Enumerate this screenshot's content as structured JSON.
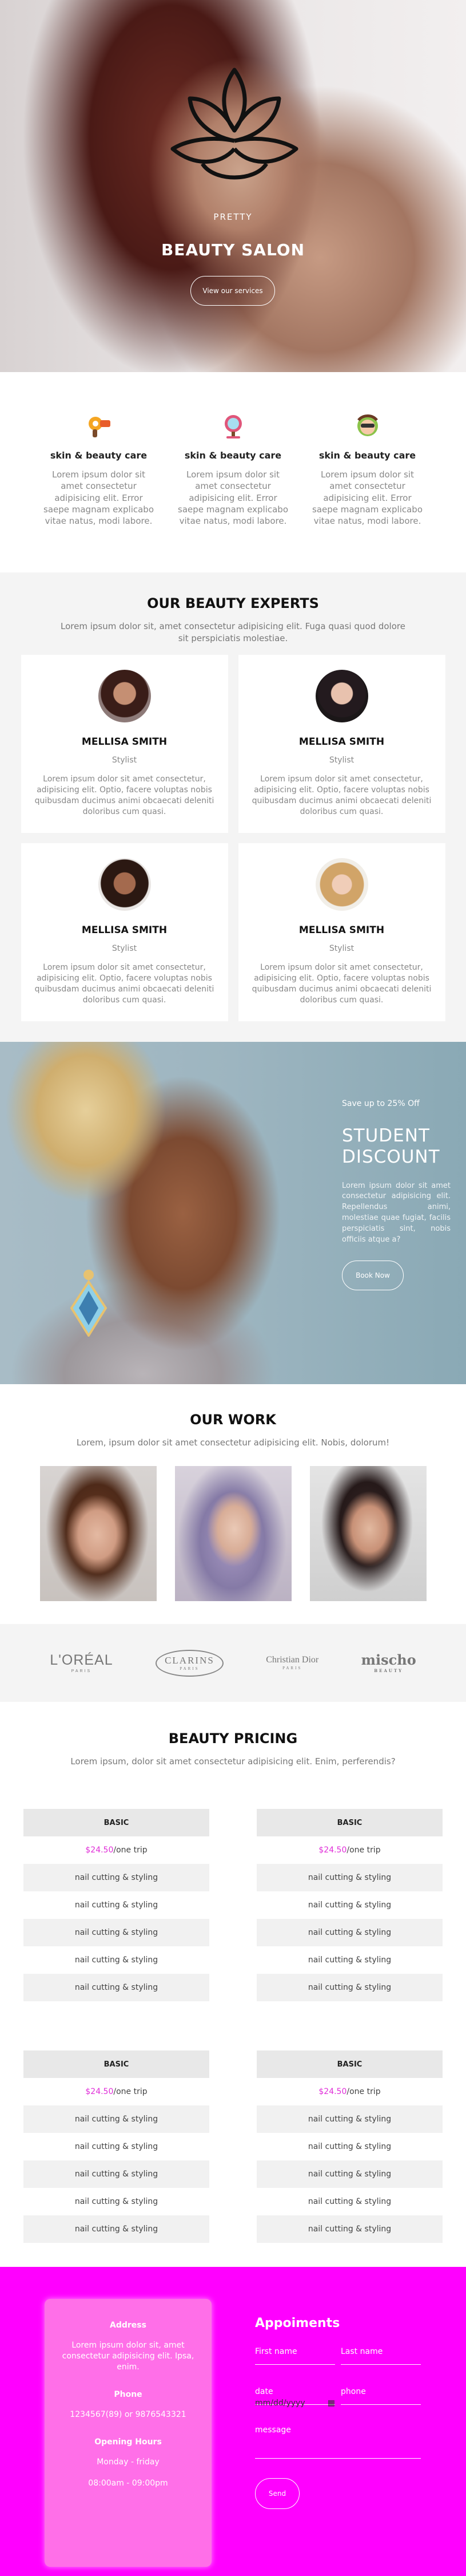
{
  "hero": {
    "tagline": "PRETTY",
    "title": "BEAUTY SALON",
    "button": "View our services"
  },
  "services": [
    {
      "icon": "hair-dryer-icon",
      "title": "skin & beauty care",
      "text": "Lorem ipsum dolor sit amet consectetur adipisicing elit. Error saepe magnam explicabo vitae natus, modi labore."
    },
    {
      "icon": "mirror-icon",
      "title": "skin & beauty care",
      "text": "Lorem ipsum dolor sit amet consectetur adipisicing elit. Error saepe magnam explicabo vitae natus, modi labore."
    },
    {
      "icon": "face-mask-icon",
      "title": "skin & beauty care",
      "text": "Lorem ipsum dolor sit amet consectetur adipisicing elit. Error saepe magnam explicabo vitae natus, modi labore."
    }
  ],
  "experts": {
    "title": "OUR BEAUTY EXPERTS",
    "subtitle": "Lorem ipsum dolor sit, amet consectetur adipisicing elit. Fuga quasi quod dolore sit perspiciatis molestiae.",
    "cards": [
      {
        "name": "MELLISA SMITH",
        "role": "Stylist",
        "text": "Lorem ipsum dolor sit amet consectetur, adipisicing elit. Optio, facere voluptas nobis quibusdam ducimus animi obcaecati deleniti doloribus cum quasi."
      },
      {
        "name": "MELLISA SMITH",
        "role": "Stylist",
        "text": "Lorem ipsum dolor sit amet consectetur, adipisicing elit. Optio, facere voluptas nobis quibusdam ducimus animi obcaecati deleniti doloribus cum quasi."
      },
      {
        "name": "MELLISA SMITH",
        "role": "Stylist",
        "text": "Lorem ipsum dolor sit amet consectetur, adipisicing elit. Optio, facere voluptas nobis quibusdam ducimus animi obcaecati deleniti doloribus cum quasi."
      },
      {
        "name": "MELLISA SMITH",
        "role": "Stylist",
        "text": "Lorem ipsum dolor sit amet consectetur, adipisicing elit. Optio, facere voluptas nobis quibusdam ducimus animi obcaecati deleniti doloribus cum quasi."
      }
    ]
  },
  "discount": {
    "save": "Save up to 25% Off",
    "title": "STUDENT DISCOUNT",
    "text": "Lorem ipsum dolor sit amet consectetur adipisicing elit. Repellendus animi, molestiae quae fugiat, facilis perspiciatis sint, nobis officiis atque a?",
    "button": "Book Now"
  },
  "work": {
    "title": "OUR WORK",
    "subtitle": "Lorem, ipsum dolor sit amet consectetur adipisicing elit. Nobis, dolorum!"
  },
  "brands": [
    {
      "name": "L'ORÉAL",
      "sub": "PARIS"
    },
    {
      "name": "CLARINS",
      "sub": "PARIS"
    },
    {
      "name": "Christian Dior",
      "sub": "PARIS"
    },
    {
      "name": "mischo",
      "sub": "BEAUTY"
    }
  ],
  "pricing": {
    "title": "BEAUTY PRICING",
    "subtitle": "Lorem ipsum, dolor sit amet consectetur adipisicing elit. Enim, perferendis?",
    "plans": [
      {
        "name": "BASIC",
        "price": "$24.50",
        "period": "/one trip",
        "items": [
          "nail cutting & styling",
          "nail cutting & styling",
          "nail cutting & styling",
          "nail cutting & styling",
          "nail cutting & styling"
        ]
      },
      {
        "name": "BASIC",
        "price": "$24.50",
        "period": "/one trip",
        "items": [
          "nail cutting & styling",
          "nail cutting & styling",
          "nail cutting & styling",
          "nail cutting & styling",
          "nail cutting & styling"
        ]
      },
      {
        "name": "BASIC",
        "price": "$24.50",
        "period": "/one trip",
        "items": [
          "nail cutting & styling",
          "nail cutting & styling",
          "nail cutting & styling",
          "nail cutting & styling",
          "nail cutting & styling"
        ]
      },
      {
        "name": "BASIC",
        "price": "$24.50",
        "period": "/one trip",
        "items": [
          "nail cutting & styling",
          "nail cutting & styling",
          "nail cutting & styling",
          "nail cutting & styling",
          "nail cutting & styling"
        ]
      }
    ]
  },
  "contact": {
    "address_label": "Address",
    "address": "Lorem ipsum dolor sit, amet consectetur adipisicing elit. Ipsa, enim.",
    "phone_label": "Phone",
    "phone": "1234567(89) or 9876543321",
    "hours_label": "Opening Hours",
    "days": "Monday - friday",
    "hours": "08:00am - 09:00pm"
  },
  "form": {
    "title": "Appoiments",
    "first_name": "First name",
    "last_name": "Last name",
    "date": "date",
    "date_placeholder": "mm/dd/yyyy",
    "phone": "phone",
    "message": "message",
    "send": "Send"
  },
  "colors": {
    "accent": "#ff00ff",
    "price": "#e02ed8"
  }
}
